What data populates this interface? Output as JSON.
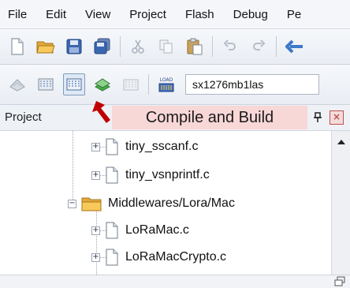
{
  "menubar": {
    "items": [
      "File",
      "Edit",
      "View",
      "Project",
      "Flash",
      "Debug",
      "Pe"
    ]
  },
  "toolbar2": {
    "load_label": "LOAD",
    "target_value": "sx1276mb1las"
  },
  "panel": {
    "title": "Project",
    "pin_glyph": "\u0004"
  },
  "tree": {
    "rows": [
      {
        "label": "tiny_sscanf.c",
        "type": "file"
      },
      {
        "label": "tiny_vsnprintf.c",
        "type": "file"
      },
      {
        "label": "Middlewares/Lora/Mac",
        "type": "folder"
      },
      {
        "label": "LoRaMac.c",
        "type": "file"
      },
      {
        "label": "LoRaMacCrypto.c",
        "type": "file"
      }
    ]
  },
  "callout": {
    "text": "Compile and Build"
  },
  "colors": {
    "callout_bg": "#f8d7d7",
    "arrow": "#c00000",
    "folder": "#f2c14e",
    "accent": "#7f9db9"
  }
}
